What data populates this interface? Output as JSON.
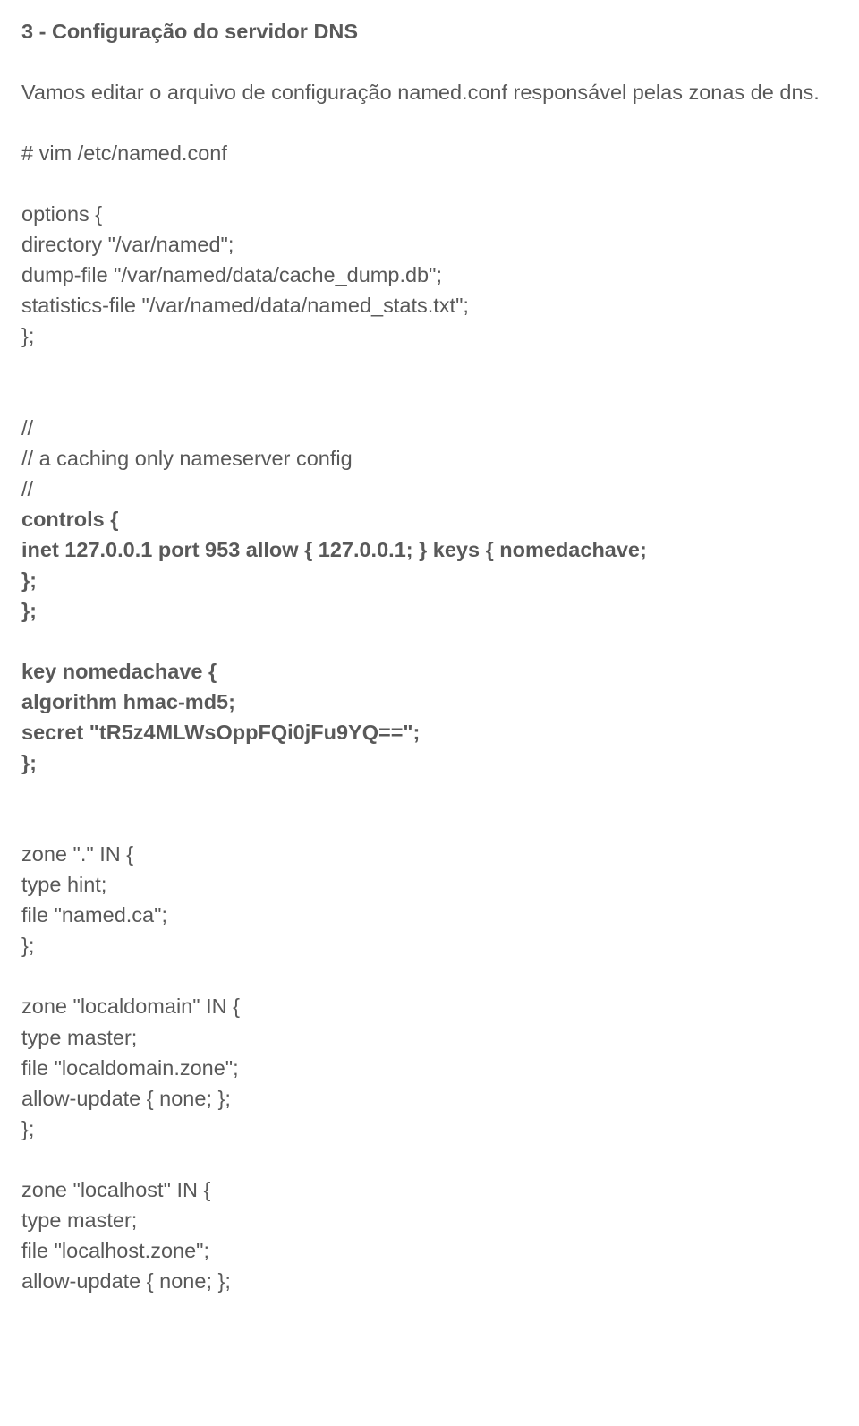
{
  "heading": "3 - Configuração do servidor DNS",
  "intro1": "Vamos editar o arquivo de configuração named.conf responsável pelas zonas de dns.",
  "cmd1": "# vim /etc/named.conf",
  "options_l1": "options {",
  "options_l2": "directory \"/var/named\";",
  "options_l3": "dump-file \"/var/named/data/cache_dump.db\";",
  "options_l4": "statistics-file \"/var/named/data/named_stats.txt\";",
  "options_l5": "};",
  "comment_l1": "//",
  "comment_l2": "// a caching only nameserver config",
  "comment_l3": "//",
  "controls_l1": "controls {",
  "controls_l2": "inet 127.0.0.1 port 953 allow { 127.0.0.1; } keys { nomedachave;",
  "controls_l3": "};",
  "controls_l4": "};",
  "key_l1": "key nomedachave {",
  "key_l2": "algorithm hmac-md5;",
  "key_l3": "secret \"tR5z4MLWsOppFQi0jFu9YQ==\";",
  "key_l4": "};",
  "zone1_l1": "zone \".\" IN {",
  "zone1_l2": "type hint;",
  "zone1_l3": "file \"named.ca\";",
  "zone1_l4": "};",
  "zone2_l1": "zone \"localdomain\" IN {",
  "zone2_l2": "type master;",
  "zone2_l3": "file \"localdomain.zone\";",
  "zone2_l4": "allow-update { none; };",
  "zone2_l5": "};",
  "zone3_l1": "zone \"localhost\" IN {",
  "zone3_l2": "type master;",
  "zone3_l3": "file \"localhost.zone\";",
  "zone3_l4": "allow-update { none; };"
}
